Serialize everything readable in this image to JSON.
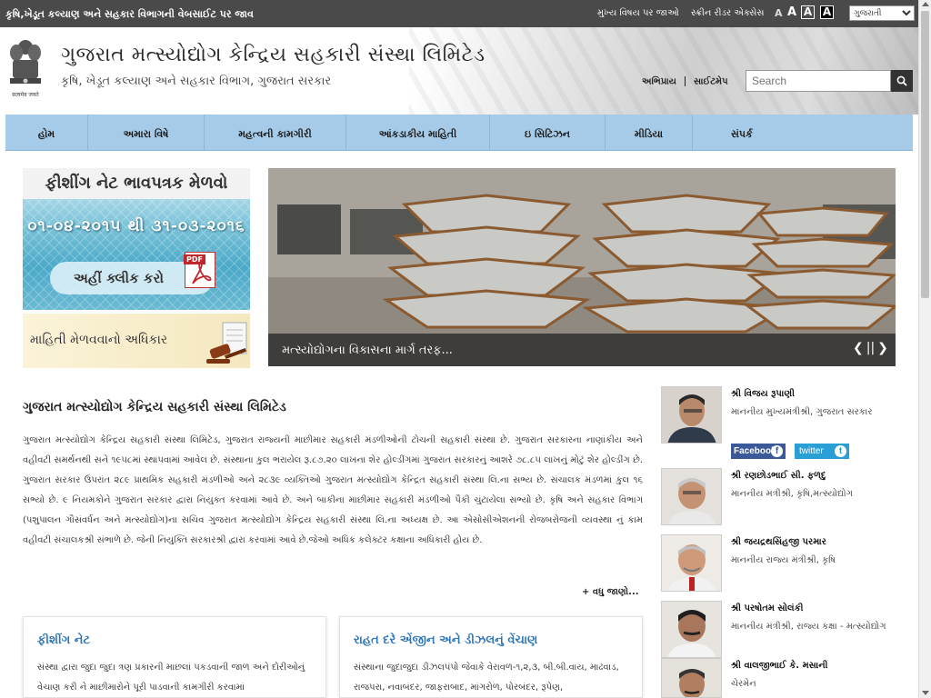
{
  "topbar": {
    "dept_link": "કૃષિ,ખેડૂત કલ્યાણ અને સહકાર વિભાગની વેબસાઈટ પર જાવ",
    "skip_to_content": "મુખ્ય વિષય પર જાઓ",
    "screen_reader": "સ્ક્રીન રીડર એક્સેસ",
    "font_small": "A",
    "font_medium": "A",
    "font_large": "A",
    "font_contrast": "A",
    "language_selected": "ગુજરાતી"
  },
  "header": {
    "title": "ગુજરાત મત્સ્યોદ્યોગ કેન્દ્રિય સહકારી સંસ્થા લિમિટેડ",
    "subtitle": "કૃષિ, ખેડૂત કલ્યાણ અને સહકાર વિભાગ, ગુજરાત સરકાર",
    "emblem_motto": "सत्यमेव जयते",
    "feedback": "અભિપ્રાય",
    "sitemap": "સાઈટમેપ",
    "search_placeholder": "Search"
  },
  "nav": {
    "items": [
      {
        "label": "હોમ"
      },
      {
        "label": "અમારા વિષે"
      },
      {
        "label": "મહત્વની કામગીરી"
      },
      {
        "label": "આંકડાકીય માહિતી"
      },
      {
        "label": "ઇ સિટિઝન"
      },
      {
        "label": "મીડિયા"
      },
      {
        "label": "સંપર્ક"
      }
    ]
  },
  "banners": {
    "net_title": "ફીશીંગ નેટ ભાવપત્રક મેળવો",
    "net_dates": "૦૧-૦૪-૨૦૧૫ થી ૩૧-૦૩-૨૦૧૬",
    "net_click": "અહીં ક્લીક કરો",
    "pdf_tag": "PDF",
    "rti": "માહિતી મેળવવાનો અધિકાર"
  },
  "slider": {
    "caption": "મત્સ્યોદ્યોગના વિકાસના માર્ગ તરફ...",
    "prev": "❮",
    "pause": "||",
    "next": "❯"
  },
  "intro": {
    "title": "ગુજરાત મત્સ્યોદ્યોગ કેન્દ્રિય સહકારી સંસ્થા લિમિટેડ",
    "text": "ગુજરાત મત્સ્યોદ્યોગ કેન્દ્રિય સહકારી સંસ્થા લિમિટેડ, ગુજરાત રાજ્યની માછીમાર સહકારી મંડળીઓની ટોચની સહકારી સંસ્થા છે. ગુજરાત સરકારના નાણાંકીય અને વહીવટી સમર્થનથી સને ૧૯૫૮માં સ્થાપવામાં આવેલ છે. સંસ્થાના કુલ ભરાયેલ રૂ.૮૭.૨૦ લાખના શેર હોલ્ડીંગમાં ગુજરાત સરકારનું આશરે ૭૮.૮૫ લાખનું મોટું શેર હોલ્ડીંગ છે. ગુજરાત સરકાર ઉપરાંત ૨૮૯ પ્રાથમિક સહકારી મંડળીઓ અને ૨૮૩૯ વ્યક્તિઓ ગુજરાત મત્સ્યોદ્યોગ કેન્દ્રિત સહકારી સંસ્થા લિ.ના સભ્ય છે. સંચાલક મંડળમાં કુલ ૧૬ સભ્યો છે. ૯ નિયમકોને ગુજરાત સરકાર દ્વારા નિયુક્ત કરવામાં આવે છે. અને બાકીના માછીમાર સહકારી મંડળીઓ પૈકી ચુંટાયેલા સભ્યો છે. કૃષિ અને સહકાર વિભાગ (પશુપાલન ગૌસંવર્ધન અને મત્સ્યોદ્યોગ)ના સચિવ ગુજરાત મત્સ્યોદ્યોગ કેન્દ્રિય સહકારી સંસ્થા લિ.ના અધ્યક્ષ છે. આ એસોસીએશનની રોજબરોજની વ્યવસ્થા નું કામ વહીવટી સંચાલકશ્રી સંભાળે છે. જેની નિયુક્તિ સરકારશ્રી દ્વારા કરવામાં આવે છે.જેઓ અધિક કલેક્ટર કક્ષાના અધિકારી હોય છે.",
    "more": "+ વધુ જાણો..."
  },
  "cards": [
    {
      "title": "ફીશીંગ નેટ",
      "text": "સંસ્થા દ્વારા જુદા જુદા ત્રણ પ્રકારની માછલાં પકડવાની જાળ અને દોરીઓનું વેચાણ કરી ને માછીમારોને પૂરી પાડવાની કામગીરી કરવામાં"
    },
    {
      "title": "રાહત દરે એંજીન અને ડીઝલનું વેંચાણ",
      "text": "સંસ્થાના જુદાજુદા ડીઝલપંપો જેવાકે વેરાવળ-૧,૨,૩, બી.બી.વાય, માઢવાડ, રાજપરા, નવાબંદર, જાફરાબાદ, માંગરોળ, પોરબંદર, રૂપેણ,"
    }
  ],
  "people": [
    {
      "name": "શ્રી વિજય રૂપાણી",
      "role": "માનનીય મુખ્યમંત્રીશ્રી, ગુજરાત સરકાર"
    },
    {
      "name": "શ્રી રણછોડભાઈ સી. ફળદુ",
      "role": "માનનીય મંત્રીશ્રી, કૃષિ,મત્સ્યોદ્યોગ"
    },
    {
      "name": "શ્રી જયદ્રથસિંહજી પરમાર",
      "role": "માનનીય રાજ્ય મંત્રીશ્રી, કૃષિ"
    },
    {
      "name": "શ્રી પરષોતમ સોલંકી",
      "role": "માનનીય મંત્રીશ્રી, રાજ્ય કક્ષા - મત્સ્યોદ્યોગ"
    },
    {
      "name": "શ્રી વાલજીભાઈ કે. મસાની",
      "role": "ચેરમેન"
    }
  ],
  "social": {
    "facebook": "Facebook",
    "facebook_icon": "f",
    "twitter": "twitter",
    "twitter_icon": "t"
  },
  "colors": {
    "topbar": "#4a4a4a",
    "nav": "#a6cbe9",
    "card_title": "#2a74b8"
  }
}
